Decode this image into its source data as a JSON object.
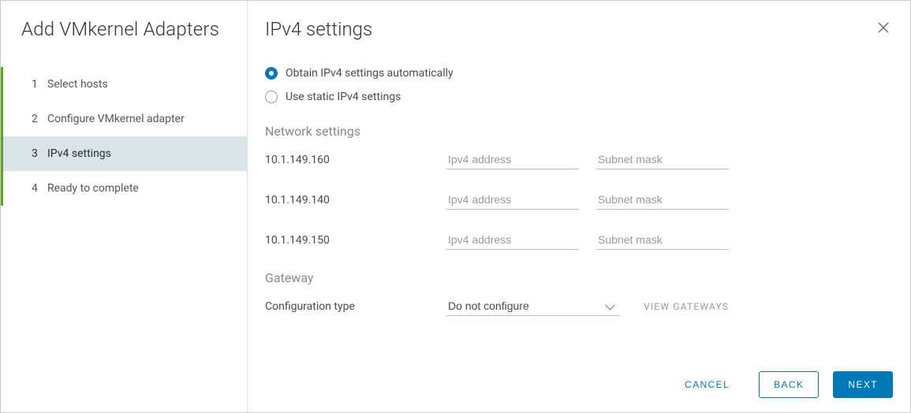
{
  "wizard": {
    "title": "Add VMkernel Adapters",
    "steps": [
      {
        "num": "1",
        "label": "Select hosts"
      },
      {
        "num": "2",
        "label": "Configure VMkernel adapter"
      },
      {
        "num": "3",
        "label": "IPv4 settings"
      },
      {
        "num": "4",
        "label": "Ready to complete"
      }
    ],
    "active_step_index": 2
  },
  "page": {
    "title": "IPv4 settings"
  },
  "ipv4_mode": {
    "selected": "auto",
    "auto_label": "Obtain IPv4 settings automatically",
    "static_label": "Use static IPv4 settings"
  },
  "network": {
    "heading": "Network settings",
    "ip_placeholder": "Ipv4 address",
    "mask_placeholder": "Subnet mask",
    "rows": [
      {
        "host": "10.1.149.160",
        "ipv4": "",
        "mask": ""
      },
      {
        "host": "10.1.149.140",
        "ipv4": "",
        "mask": ""
      },
      {
        "host": "10.1.149.150",
        "ipv4": "",
        "mask": ""
      }
    ]
  },
  "gateway": {
    "heading": "Gateway",
    "config_label": "Configuration type",
    "selected": "Do not configure",
    "options": [
      "Do not configure"
    ],
    "view_label": "VIEW GATEWAYS"
  },
  "footer": {
    "cancel": "CANCEL",
    "back": "BACK",
    "next": "NEXT"
  }
}
